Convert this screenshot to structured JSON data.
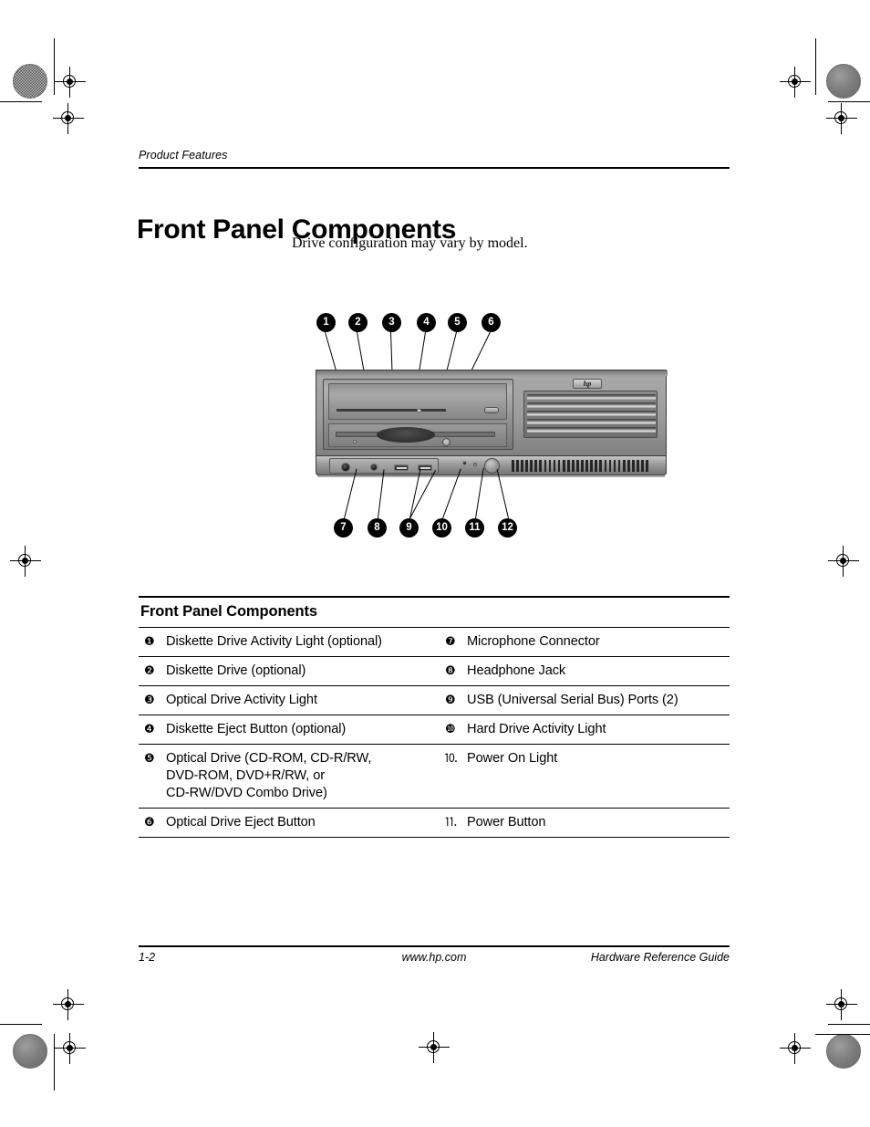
{
  "document": {
    "running_head": "Product Features",
    "chapter_title": "Front Panel Components",
    "intro_text": "Drive configuration may vary by model."
  },
  "figure": {
    "callouts_top": [
      {
        "number": "1"
      },
      {
        "number": "2"
      },
      {
        "number": "3"
      },
      {
        "number": "4"
      },
      {
        "number": "5"
      },
      {
        "number": "6"
      }
    ],
    "callouts_bottom": [
      {
        "number": "7"
      },
      {
        "number": "8"
      },
      {
        "number": "9"
      },
      {
        "number": "10"
      },
      {
        "number": "11"
      },
      {
        "number": "12"
      }
    ],
    "brand_logo": "hp"
  },
  "table": {
    "title": "Front Panel Components",
    "rows": [
      {
        "left_bullet": "❶",
        "left_label": "Diskette Drive Activity Light (optional)",
        "right_bullet": "❼",
        "right_label": "Microphone Connector"
      },
      {
        "left_bullet": "❷",
        "left_label": "Diskette Drive (optional)",
        "right_bullet": "❽",
        "right_label": "Headphone Jack"
      },
      {
        "left_bullet": "❸",
        "left_label": "Optical Drive Activity Light",
        "right_bullet": "❾",
        "right_label": "USB (Universal Serial Bus) Ports (2)"
      },
      {
        "left_bullet": "❹",
        "left_label": "Diskette Eject Button (optional)",
        "right_bullet": "❿",
        "right_label": "Hard Drive Activity Light"
      },
      {
        "left_bullet": "❺",
        "left_label": "Optical Drive (CD-ROM, CD-R/RW,\nDVD-ROM, DVD+R/RW, or\nCD-RW/DVD Combo Drive)",
        "right_bullet": "⒑",
        "right_label": "Power On Light"
      },
      {
        "left_bullet": "❻",
        "left_label": "Optical Drive Eject Button",
        "right_bullet": "⒒",
        "right_label": "Power Button"
      }
    ]
  },
  "footer": {
    "page_number": "1-2",
    "website": "www.hp.com",
    "guide_title": "Hardware Reference Guide"
  }
}
